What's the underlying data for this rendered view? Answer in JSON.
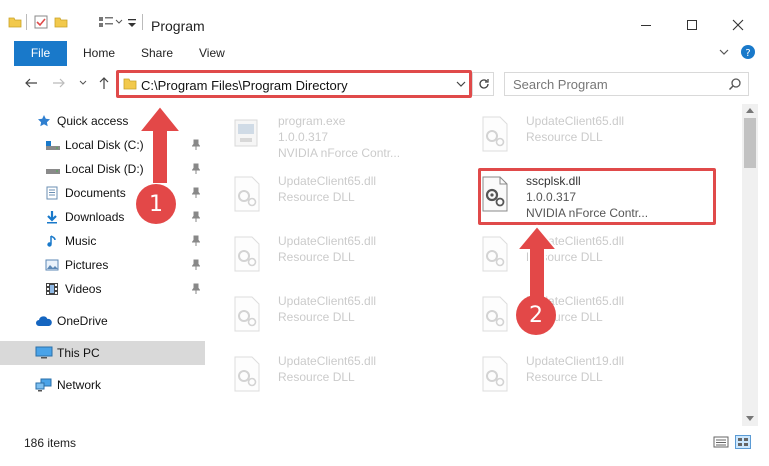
{
  "window": {
    "title": "Program",
    "quick_access_toolbar": [
      "folder-icon",
      "properties-icon",
      "new-folder-icon",
      "customize-icon"
    ],
    "controls": [
      "minimize-icon",
      "maximize-icon",
      "close-icon"
    ]
  },
  "ribbon": {
    "tabs": [
      {
        "label": "File",
        "active": true
      },
      {
        "label": "Home"
      },
      {
        "label": "Share"
      },
      {
        "label": "View"
      }
    ],
    "accent": "#1979ca"
  },
  "address": {
    "path": "C:\\Program Files\\Program Directory",
    "search_placeholder": "Search Program"
  },
  "navpane": {
    "items": [
      {
        "label": "Quick access",
        "icon": "star-icon"
      },
      {
        "label": "Local Disk (C:)",
        "icon": "drive-icon",
        "pinned": true
      },
      {
        "label": "Local Disk (D:)",
        "icon": "drive-icon",
        "pinned": true
      },
      {
        "label": "Documents",
        "icon": "documents-icon",
        "pinned": true
      },
      {
        "label": "Downloads",
        "icon": "downloads-icon",
        "pinned": true
      },
      {
        "label": "Music",
        "icon": "music-icon",
        "pinned": true
      },
      {
        "label": "Pictures",
        "icon": "pictures-icon",
        "pinned": true
      },
      {
        "label": "Videos",
        "icon": "videos-icon",
        "pinned": true
      },
      {
        "label": "OneDrive",
        "icon": "cloud-icon"
      },
      {
        "label": "This PC",
        "icon": "computer-icon",
        "selected": true
      },
      {
        "label": "Network",
        "icon": "network-icon"
      }
    ]
  },
  "files": [
    {
      "name": "program.exe",
      "line2": "1.0.0.317",
      "line3": "NVIDIA nForce Contr...",
      "faded": true,
      "type": "exe"
    },
    {
      "name": "UpdateClient65.dll",
      "line2": "Resource DLL",
      "faded": true,
      "type": "dll"
    },
    {
      "name": "UpdateClient65.dll",
      "line2": "Resource DLL",
      "faded": true,
      "type": "dll"
    },
    {
      "name": "sscplsk.dll",
      "line2": "1.0.0.317",
      "line3": "NVIDIA nForce Contr...",
      "faded": false,
      "type": "dll"
    },
    {
      "name": "UpdateClient65.dll",
      "line2": "Resource DLL",
      "faded": true,
      "type": "dll"
    },
    {
      "name": "UpdateClient65.dll",
      "line2": "Resource DLL",
      "faded": true,
      "type": "dll"
    },
    {
      "name": "UpdateClient65.dll",
      "line2": "Resource DLL",
      "faded": true,
      "type": "dll"
    },
    {
      "name": "UpdateClient65.dll",
      "line2": "Resource DLL",
      "faded": true,
      "type": "dll"
    },
    {
      "name": "UpdateClient65.dll",
      "line2": "Resource DLL",
      "faded": true,
      "type": "dll"
    },
    {
      "name": "UpdateClient19.dll",
      "line2": "Resource DLL",
      "faded": true,
      "type": "dll"
    }
  ],
  "status": {
    "count": "186 items"
  },
  "annotations": {
    "callouts": [
      "1",
      "2"
    ],
    "color": "#e34848"
  }
}
